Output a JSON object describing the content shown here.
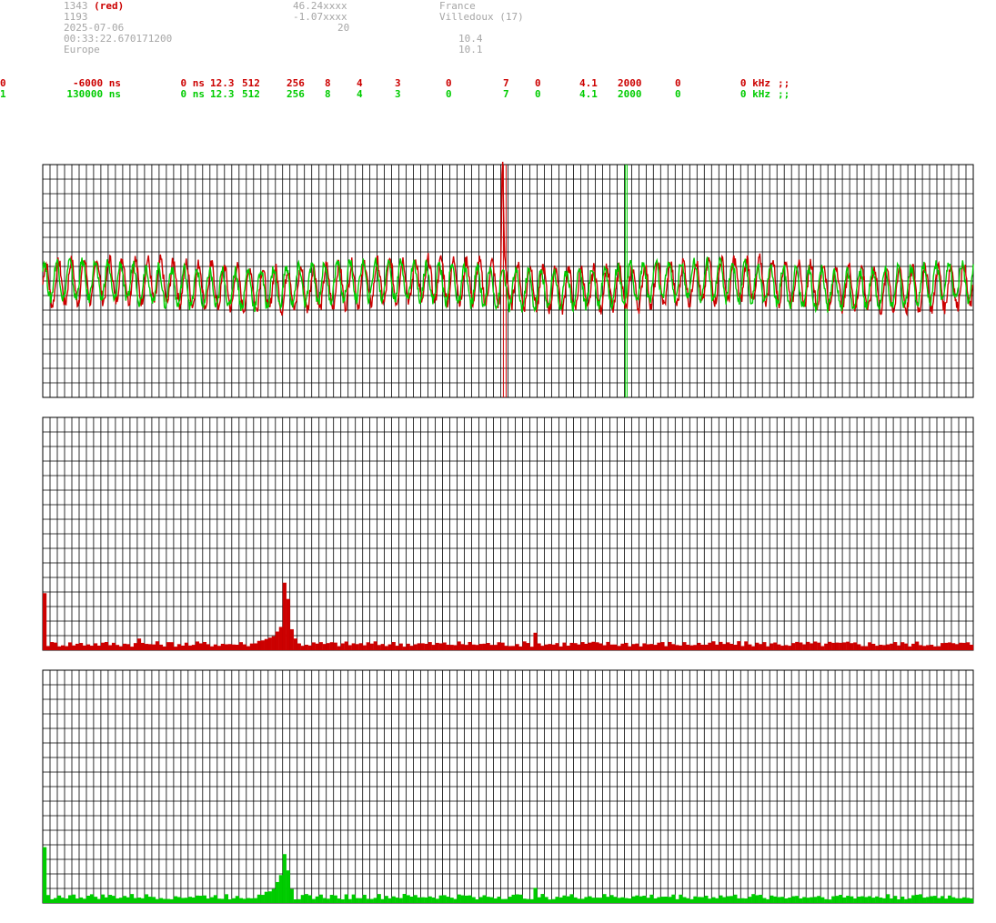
{
  "header": {
    "col1": [
      "1343",
      "1193",
      "2025-07-06",
      "00:33:22.670171200",
      "Europe"
    ],
    "col1_red": "(red)",
    "col2": [
      "46.24xxxx",
      "-1.07xxxx",
      "20"
    ],
    "col3": [
      "France",
      "Villedoux (17)"
    ],
    "col4": [
      "10.4",
      "10.1"
    ]
  },
  "rows": [
    {
      "id": "0",
      "color": "#cc0000",
      "cells": [
        "-6000 ns",
        "0 ns",
        "12.3",
        "512",
        "256",
        "8",
        "4",
        "3",
        "0",
        "7",
        "0",
        "4.1",
        "2000",
        "0",
        "0 kHz",
        ";;"
      ]
    },
    {
      "id": "1",
      "color": "#00cc00",
      "cells": [
        "130000 ns",
        "0 ns",
        "12.3",
        "512",
        "256",
        "8",
        "4",
        "3",
        "0",
        "7",
        "0",
        "4.1",
        "2000",
        "0",
        "0 kHz",
        ";;"
      ]
    }
  ],
  "colors": {
    "red": "#cc0000",
    "green": "#00cc00",
    "grid": "#000000",
    "text_grey": "#a6a6a6"
  },
  "chart_data": [
    {
      "type": "line",
      "series": [
        {
          "color": "#cc0000",
          "cycles": 73,
          "amplitude": 0.18,
          "spike_at": 0.494,
          "spike_peak": 0.95,
          "marker_at": 0.496
        },
        {
          "color": "#00cc00",
          "cycles": 73,
          "amplitude": 0.16,
          "marker_at": 0.626
        }
      ],
      "ylim": [
        -1,
        1
      ],
      "grid": true
    },
    {
      "type": "bar",
      "color": "#cc0000",
      "bins": 256,
      "baseline": 0.03,
      "peaks": [
        {
          "bin": 0,
          "value": 0.245
        },
        {
          "bin": 26,
          "value": 0.05
        },
        {
          "bin": 40,
          "value": 0.02
        },
        {
          "bin": 55,
          "value": 0.025
        },
        {
          "bin": 59,
          "value": 0.04
        },
        {
          "bin": 64,
          "value": 0.08
        },
        {
          "bin": 65,
          "value": 0.1
        },
        {
          "bin": 66,
          "value": 0.29
        },
        {
          "bin": 67,
          "value": 0.22
        },
        {
          "bin": 68,
          "value": 0.09
        },
        {
          "bin": 69,
          "value": 0.05
        },
        {
          "bin": 135,
          "value": 0.075
        }
      ],
      "grid": true
    },
    {
      "type": "bar",
      "color": "#00cc00",
      "bins": 256,
      "baseline": 0.03,
      "peaks": [
        {
          "bin": 0,
          "value": 0.24
        },
        {
          "bin": 60,
          "value": 0.035
        },
        {
          "bin": 62,
          "value": 0.05
        },
        {
          "bin": 64,
          "value": 0.09
        },
        {
          "bin": 65,
          "value": 0.12
        },
        {
          "bin": 66,
          "value": 0.21
        },
        {
          "bin": 67,
          "value": 0.14
        },
        {
          "bin": 68,
          "value": 0.06
        },
        {
          "bin": 135,
          "value": 0.065
        }
      ],
      "grid": true
    }
  ]
}
